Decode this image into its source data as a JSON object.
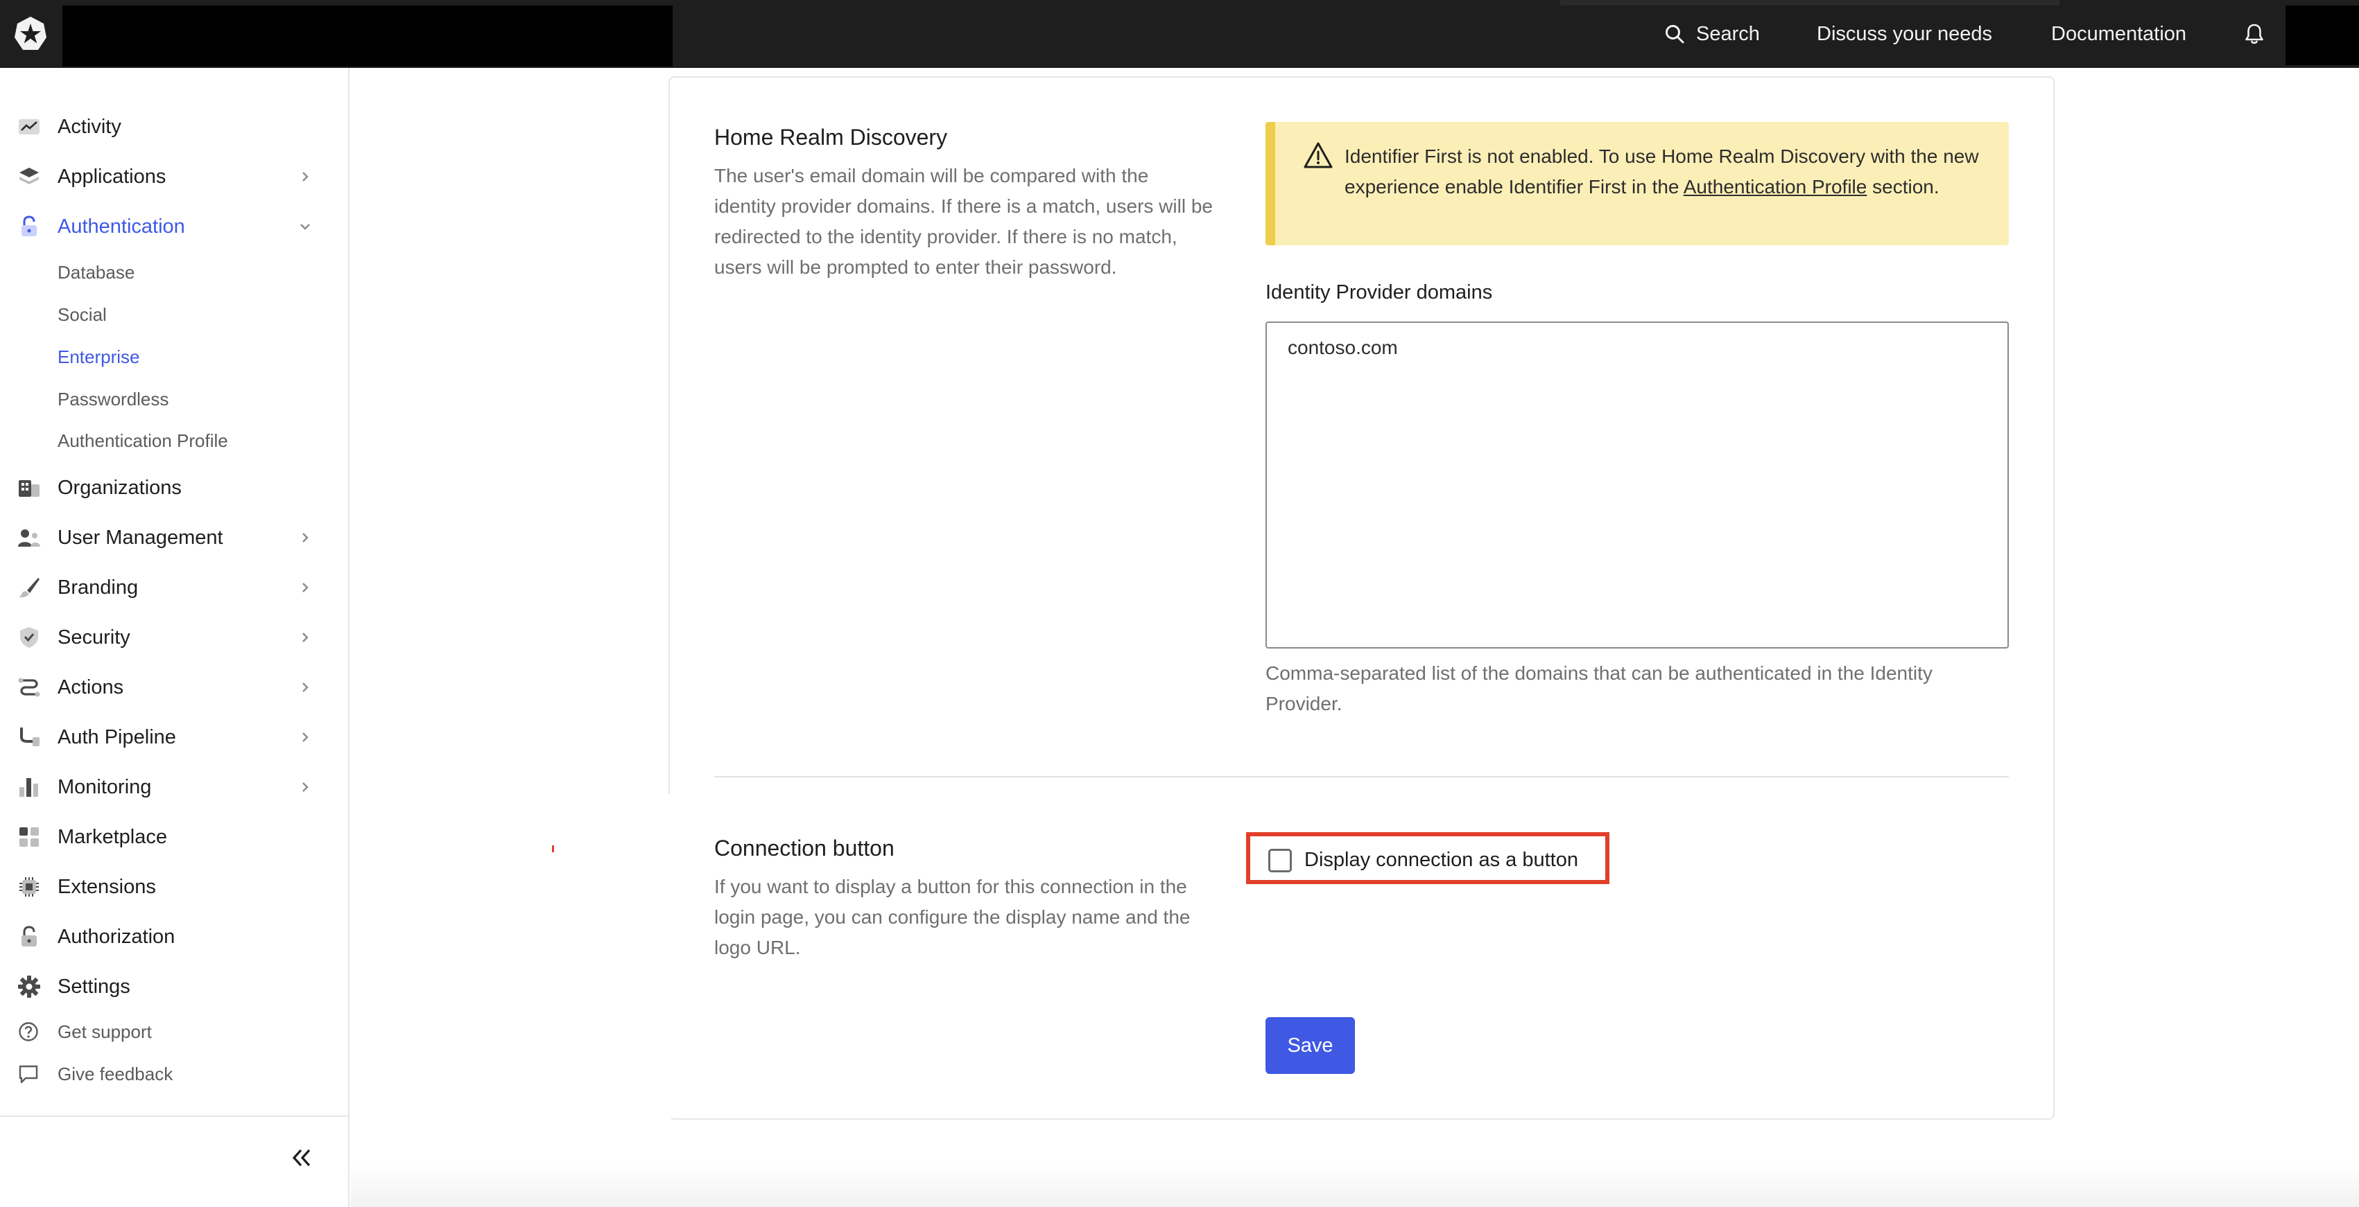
{
  "topbar": {
    "search_label": "Search",
    "discuss_label": "Discuss your needs",
    "docs_label": "Documentation",
    "icons": [
      "auth0-logo-icon",
      "search-icon",
      "bell-icon"
    ]
  },
  "sidebar": {
    "items": [
      {
        "label": "Activity",
        "icon": "activity-icon"
      },
      {
        "label": "Applications",
        "icon": "applications-icon"
      },
      {
        "label": "Authentication",
        "icon": "lock-icon",
        "active": true
      },
      {
        "label": "Organizations",
        "icon": "organizations-icon"
      },
      {
        "label": "User Management",
        "icon": "users-icon"
      },
      {
        "label": "Branding",
        "icon": "brush-icon"
      },
      {
        "label": "Security",
        "icon": "shield-icon"
      },
      {
        "label": "Actions",
        "icon": "actions-icon"
      },
      {
        "label": "Auth Pipeline",
        "icon": "pipeline-icon"
      },
      {
        "label": "Monitoring",
        "icon": "bar-chart-icon"
      },
      {
        "label": "Marketplace",
        "icon": "marketplace-icon"
      },
      {
        "label": "Extensions",
        "icon": "chip-icon"
      },
      {
        "label": "Authorization",
        "icon": "lock-icon"
      },
      {
        "label": "Settings",
        "icon": "gear-icon"
      }
    ],
    "auth_sub_items": [
      {
        "label": "Database"
      },
      {
        "label": "Social"
      },
      {
        "label": "Enterprise",
        "active": true
      },
      {
        "label": "Passwordless"
      },
      {
        "label": "Authentication Profile"
      }
    ],
    "footer_items": [
      {
        "label": "Get support",
        "icon": "help-circle-icon"
      },
      {
        "label": "Give feedback",
        "icon": "chat-bubble-icon"
      }
    ],
    "collapse_icon": "double-chevron-left-icon"
  },
  "home_realm": {
    "title": "Home Realm Discovery",
    "description": "The user's email domain will be compared with the identity provider domains. If there is a match, users will be redirected to the identity provider. If there is no match, users will be prompted to enter their password.",
    "alert_text_before": "Identifier First is not enabled. To use Home Realm Discovery with the new experience enable Identifier First in the ",
    "alert_link": "Authentication Profile",
    "alert_text_after": " section.",
    "alert_icon": "warning-triangle-icon",
    "field_label": "Identity Provider domains",
    "field_value": "contoso.com",
    "field_help": "Comma-separated list of the domains that can be authenticated in the Identity Provider."
  },
  "connection_button": {
    "title": "Connection button",
    "description": "If you want to display a button for this connection in the login page, you can configure the display name and the logo URL.",
    "checkbox_label": "Display connection as a button",
    "checked": false
  },
  "save_label": "Save",
  "colors": {
    "accent": "#3f59e4",
    "topbar": "#1e1e1e",
    "alert_bg": "#fbefb7",
    "alert_border": "#ecce4a",
    "highlight": "#e0402a"
  }
}
